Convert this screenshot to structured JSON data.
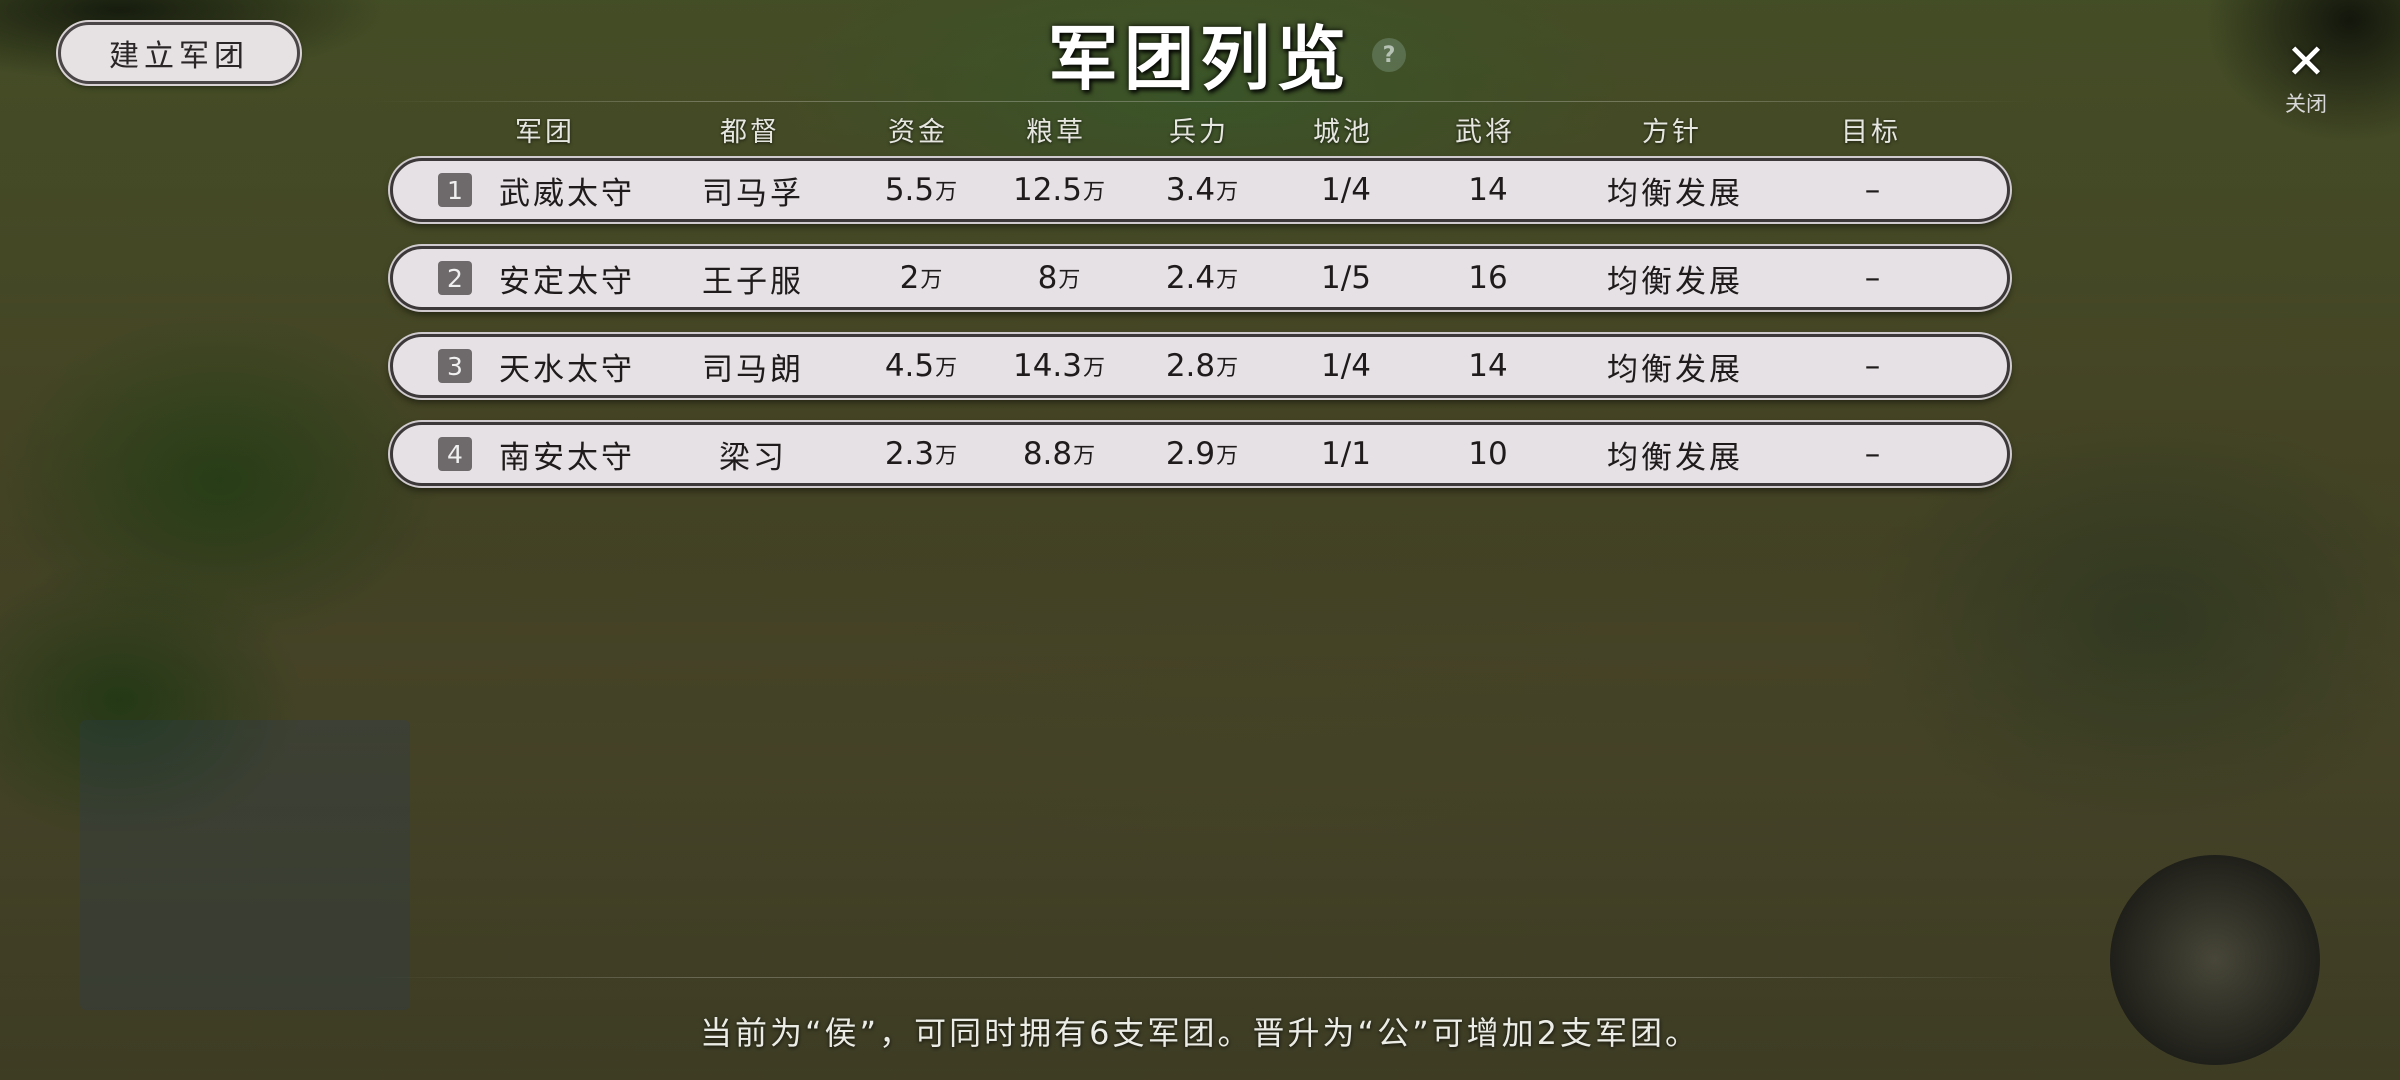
{
  "header": {
    "create_button": "建立军团",
    "title": "军团列览",
    "help_icon": "?",
    "close_icon": "✕",
    "close_label": "关闭"
  },
  "table": {
    "columns": [
      "军团",
      "都督",
      "资金",
      "粮草",
      "兵力",
      "城池",
      "武将",
      "方针",
      "目标"
    ],
    "rows": [
      {
        "index": "1",
        "legion": "武威太守",
        "commander": "司马孚",
        "funds": "5.5",
        "funds_unit": "万",
        "food": "12.5",
        "food_unit": "万",
        "troops": "3.4",
        "troops_unit": "万",
        "cities": "1/4",
        "generals": "14",
        "policy": "均衡发展",
        "target": "–"
      },
      {
        "index": "2",
        "legion": "安定太守",
        "commander": "王子服",
        "funds": "2",
        "funds_unit": "万",
        "food": "8",
        "food_unit": "万",
        "troops": "2.4",
        "troops_unit": "万",
        "cities": "1/5",
        "generals": "16",
        "policy": "均衡发展",
        "target": "–"
      },
      {
        "index": "3",
        "legion": "天水太守",
        "commander": "司马朗",
        "funds": "4.5",
        "funds_unit": "万",
        "food": "14.3",
        "food_unit": "万",
        "troops": "2.8",
        "troops_unit": "万",
        "cities": "1/4",
        "generals": "14",
        "policy": "均衡发展",
        "target": "–"
      },
      {
        "index": "4",
        "legion": "南安太守",
        "commander": "梁习",
        "funds": "2.3",
        "funds_unit": "万",
        "food": "8.8",
        "food_unit": "万",
        "troops": "2.9",
        "troops_unit": "万",
        "cities": "1/1",
        "generals": "10",
        "policy": "均衡发展",
        "target": "–"
      }
    ]
  },
  "footer": {
    "info": "当前为“侯”，可同时拥有6支军团。晋升为“公”可增加2支军团。"
  }
}
